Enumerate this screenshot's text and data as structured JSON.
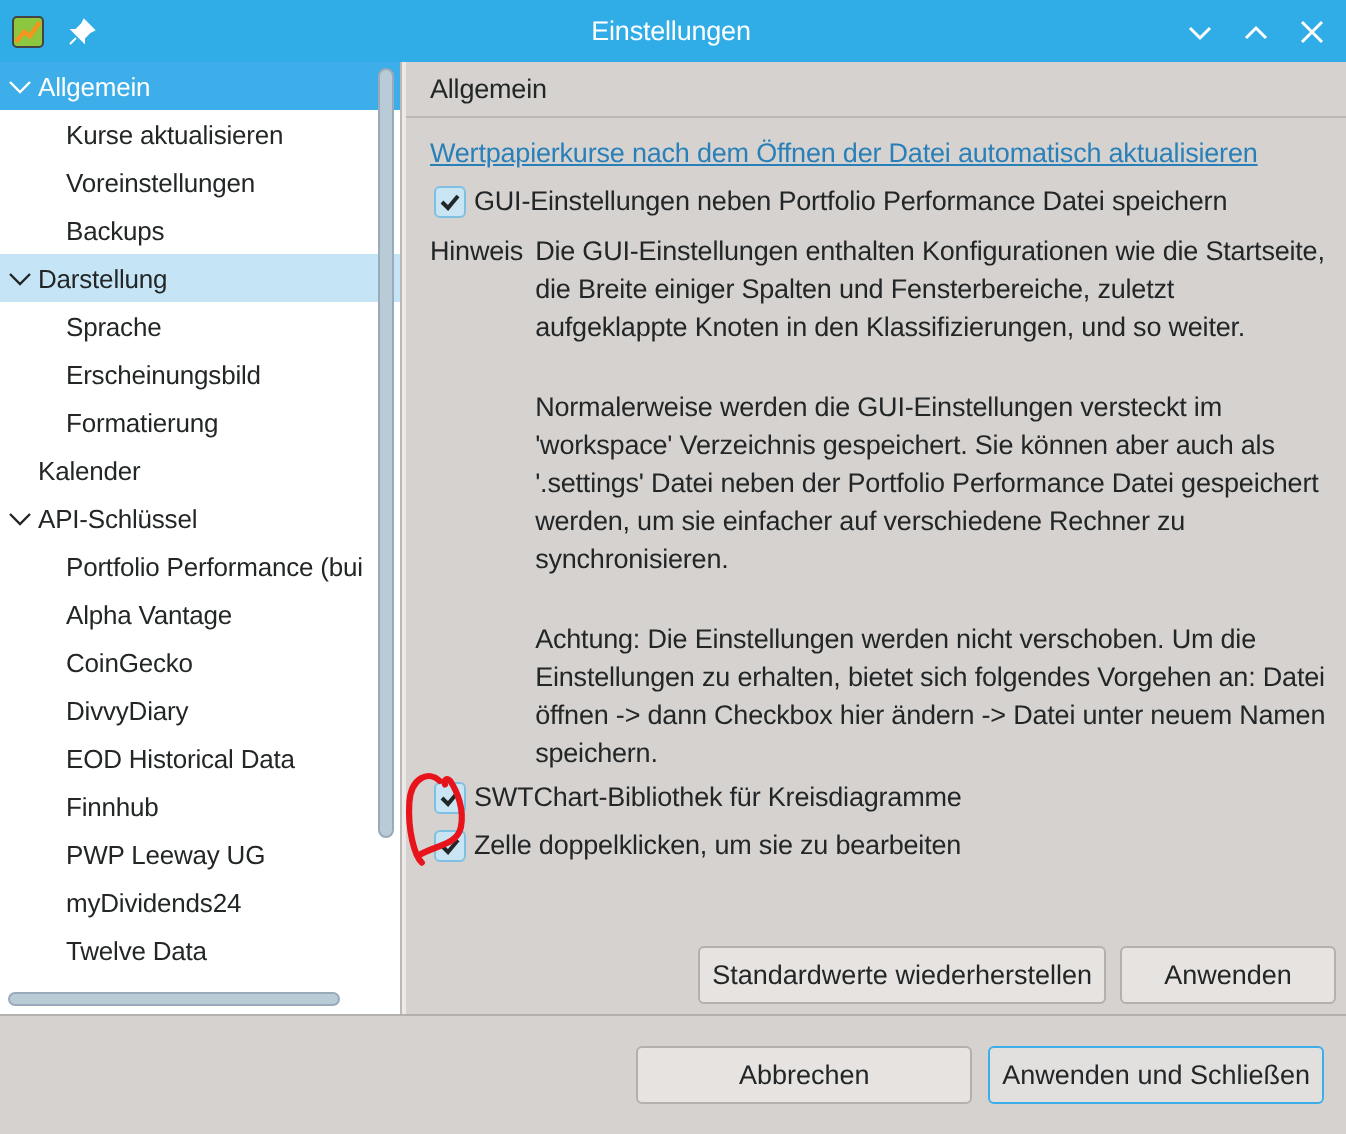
{
  "window": {
    "title": "Einstellungen"
  },
  "sidebar": {
    "items": [
      {
        "label": "Allgemein",
        "expanded": true,
        "selected": true,
        "children": [
          {
            "label": "Kurse aktualisieren",
            "selected": false
          },
          {
            "label": "Voreinstellungen",
            "selected": false
          },
          {
            "label": "Backups",
            "selected": false
          }
        ]
      },
      {
        "label": "Darstellung",
        "expanded": true,
        "selected": false,
        "hovered": true,
        "children": [
          {
            "label": "Sprache",
            "selected": false
          },
          {
            "label": "Erscheinungsbild",
            "selected": false
          },
          {
            "label": "Formatierung",
            "selected": false
          }
        ]
      },
      {
        "label": "Kalender",
        "selected": false
      },
      {
        "label": "API-Schlüssel",
        "expanded": true,
        "selected": false,
        "children": [
          {
            "label": "Portfolio Performance (bui",
            "selected": false
          },
          {
            "label": "Alpha Vantage",
            "selected": false
          },
          {
            "label": "CoinGecko",
            "selected": false
          },
          {
            "label": "DivvyDiary",
            "selected": false
          },
          {
            "label": "EOD Historical Data",
            "selected": false
          },
          {
            "label": "Finnhub",
            "selected": false
          },
          {
            "label": "PWP Leeway UG",
            "selected": false
          },
          {
            "label": "myDividends24",
            "selected": false
          },
          {
            "label": "Twelve Data",
            "selected": false
          }
        ]
      }
    ]
  },
  "page": {
    "title": "Allgemein",
    "link": "Wertpapierkurse nach dem Öffnen der Datei automatisch aktualisieren",
    "options": [
      {
        "kind": "checkbox",
        "label": "GUI-Einstellungen neben Portfolio Performance Datei speichern",
        "checked": true
      },
      {
        "kind": "note",
        "label": "Hinweis",
        "paragraphs": [
          "Die GUI-Einstellungen enthalten Konfigurationen wie die Startseite, die Breite einiger Spalten und Fensterbereiche, zuletzt aufgeklappte Knoten in den Klassifizierungen, und so weiter.",
          "Normalerweise werden die GUI-Einstellungen versteckt im 'workspace' Verzeichnis gespeichert. Sie können aber auch als '.settings' Datei neben der Portfolio Performance Datei gespeichert werden, um sie einfacher auf verschiedene Rechner zu synchronisieren.",
          "Achtung: Die Einstellungen werden nicht verschoben. Um die Einstellungen zu erhalten, bietet sich folgendes Vorgehen an: Datei öffnen -> dann Checkbox hier ändern -> Datei unter neuem Namen speichern."
        ]
      },
      {
        "kind": "checkbox",
        "label": "SWTChart-Bibliothek für Kreisdiagramme",
        "checked": true
      },
      {
        "kind": "checkbox",
        "label": "Zelle doppelklicken, um sie zu bearbeiten",
        "checked": true
      }
    ],
    "buttons": [
      "Standardwerte wiederherstellen",
      "Anwenden"
    ]
  },
  "footer_buttons": [
    {
      "label": "Abbrechen",
      "default": false
    },
    {
      "label": "Anwenden und Schließen",
      "default": true
    }
  ]
}
